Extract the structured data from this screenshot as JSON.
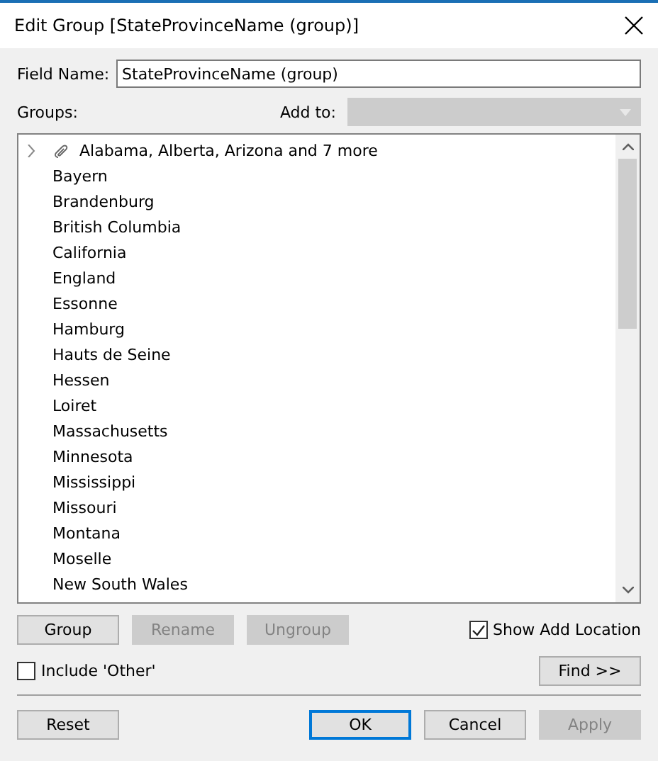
{
  "window": {
    "title": "Edit Group [StateProvinceName (group)]"
  },
  "field_name": {
    "label": "Field Name:",
    "value": "StateProvinceName (group)"
  },
  "groups_label": "Groups:",
  "add_to": {
    "label": "Add to:",
    "disabled": true
  },
  "groups": [
    {
      "kind": "group",
      "label": "Alabama, Alberta, Arizona and 7 more",
      "expanded": false
    },
    {
      "kind": "member",
      "label": "Bayern"
    },
    {
      "kind": "member",
      "label": "Brandenburg"
    },
    {
      "kind": "member",
      "label": "British Columbia"
    },
    {
      "kind": "member",
      "label": "California"
    },
    {
      "kind": "member",
      "label": "England"
    },
    {
      "kind": "member",
      "label": "Essonne"
    },
    {
      "kind": "member",
      "label": "Hamburg"
    },
    {
      "kind": "member",
      "label": "Hauts de Seine"
    },
    {
      "kind": "member",
      "label": "Hessen"
    },
    {
      "kind": "member",
      "label": "Loiret"
    },
    {
      "kind": "member",
      "label": "Massachusetts"
    },
    {
      "kind": "member",
      "label": "Minnesota"
    },
    {
      "kind": "member",
      "label": "Mississippi"
    },
    {
      "kind": "member",
      "label": "Missouri"
    },
    {
      "kind": "member",
      "label": "Montana"
    },
    {
      "kind": "member",
      "label": "Moselle"
    },
    {
      "kind": "member",
      "label": "New South Wales"
    }
  ],
  "group_buttons": [
    {
      "label": "Group",
      "disabled": false
    },
    {
      "label": "Rename",
      "disabled": true
    },
    {
      "label": "Ungroup",
      "disabled": true
    }
  ],
  "show_add_location": {
    "label": "Show Add Location",
    "checked": true
  },
  "include_other": {
    "label": "Include 'Other'",
    "checked": false
  },
  "find_button": {
    "label": "Find >>",
    "disabled": false
  },
  "footer_buttons": [
    {
      "label": "Reset",
      "disabled": false,
      "default": false
    },
    {
      "label": "OK",
      "disabled": false,
      "default": true
    },
    {
      "label": "Cancel",
      "disabled": false,
      "default": false
    },
    {
      "label": "Apply",
      "disabled": true,
      "default": false
    }
  ]
}
